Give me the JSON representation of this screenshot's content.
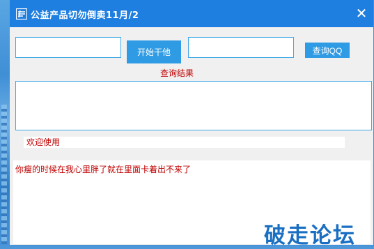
{
  "window": {
    "title": "公益产品切勿倒卖11月/2",
    "close_symbol": "✕"
  },
  "inputs": {
    "first_value": "",
    "second_value": ""
  },
  "buttons": {
    "start_label": "开始干他",
    "query_qq_label": "查询QQ"
  },
  "result": {
    "label": "查询结果",
    "content": ""
  },
  "status": {
    "text": "欢迎使用"
  },
  "log": {
    "text": "你瘦的时候在我心里胖了就在里面卡着出不来了"
  },
  "watermark": {
    "text": "破走论坛"
  },
  "colors": {
    "titlebar": "#1f7fe0",
    "accent_button": "#2e9be4",
    "border": "#3da6e8",
    "red_text": "#c00000",
    "watermark": "#1a6fc2"
  },
  "icons": {
    "app": "app-logo-icon",
    "close": "close-icon"
  }
}
